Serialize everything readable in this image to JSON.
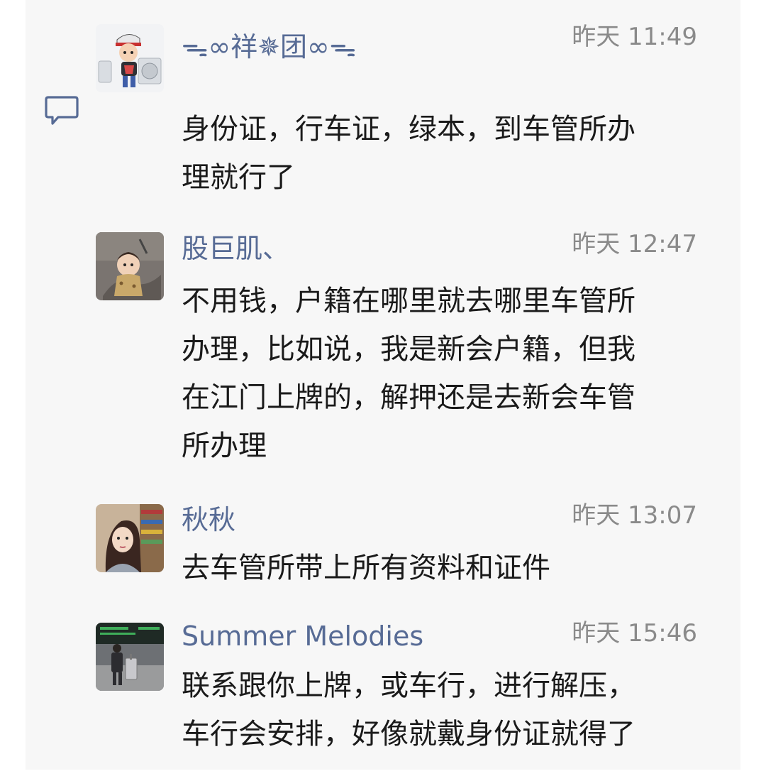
{
  "comments": [
    {
      "name": "ᯓ∞祥✵团∞ᯓ",
      "time": "昨天 11:49",
      "lines": [
        "身份证，行车证，绿本，到车管所办",
        "理就行了"
      ],
      "avatar": "cartoon-boy-avatar"
    },
    {
      "name": "股巨肌、",
      "time": "昨天 12:47",
      "lines": [
        "不用钱，户籍在哪里就去哪里车管所",
        "办理，比如说，我是新会户籍，但我",
        "在江门上牌的，解押还是去新会车管",
        "所办理"
      ],
      "avatar": "baby-photo-avatar"
    },
    {
      "name": "秋秋",
      "time": "昨天 13:07",
      "lines": [
        "去车管所带上所有资料和证件"
      ],
      "avatar": "girl-portrait-avatar"
    },
    {
      "name": "Summer Melodies",
      "time": "昨天 15:46",
      "lines": [
        "联系跟你上牌，或车行，进行解压，",
        "车行会安排，好像就戴身份证就得了"
      ],
      "avatar": "airport-photo-avatar"
    }
  ],
  "colors": {
    "name": "#576b95",
    "time": "#8a8a8a",
    "text": "#1a1a1a",
    "panel": "#f7f7f7"
  },
  "icons": {
    "comment": "comment-icon"
  }
}
